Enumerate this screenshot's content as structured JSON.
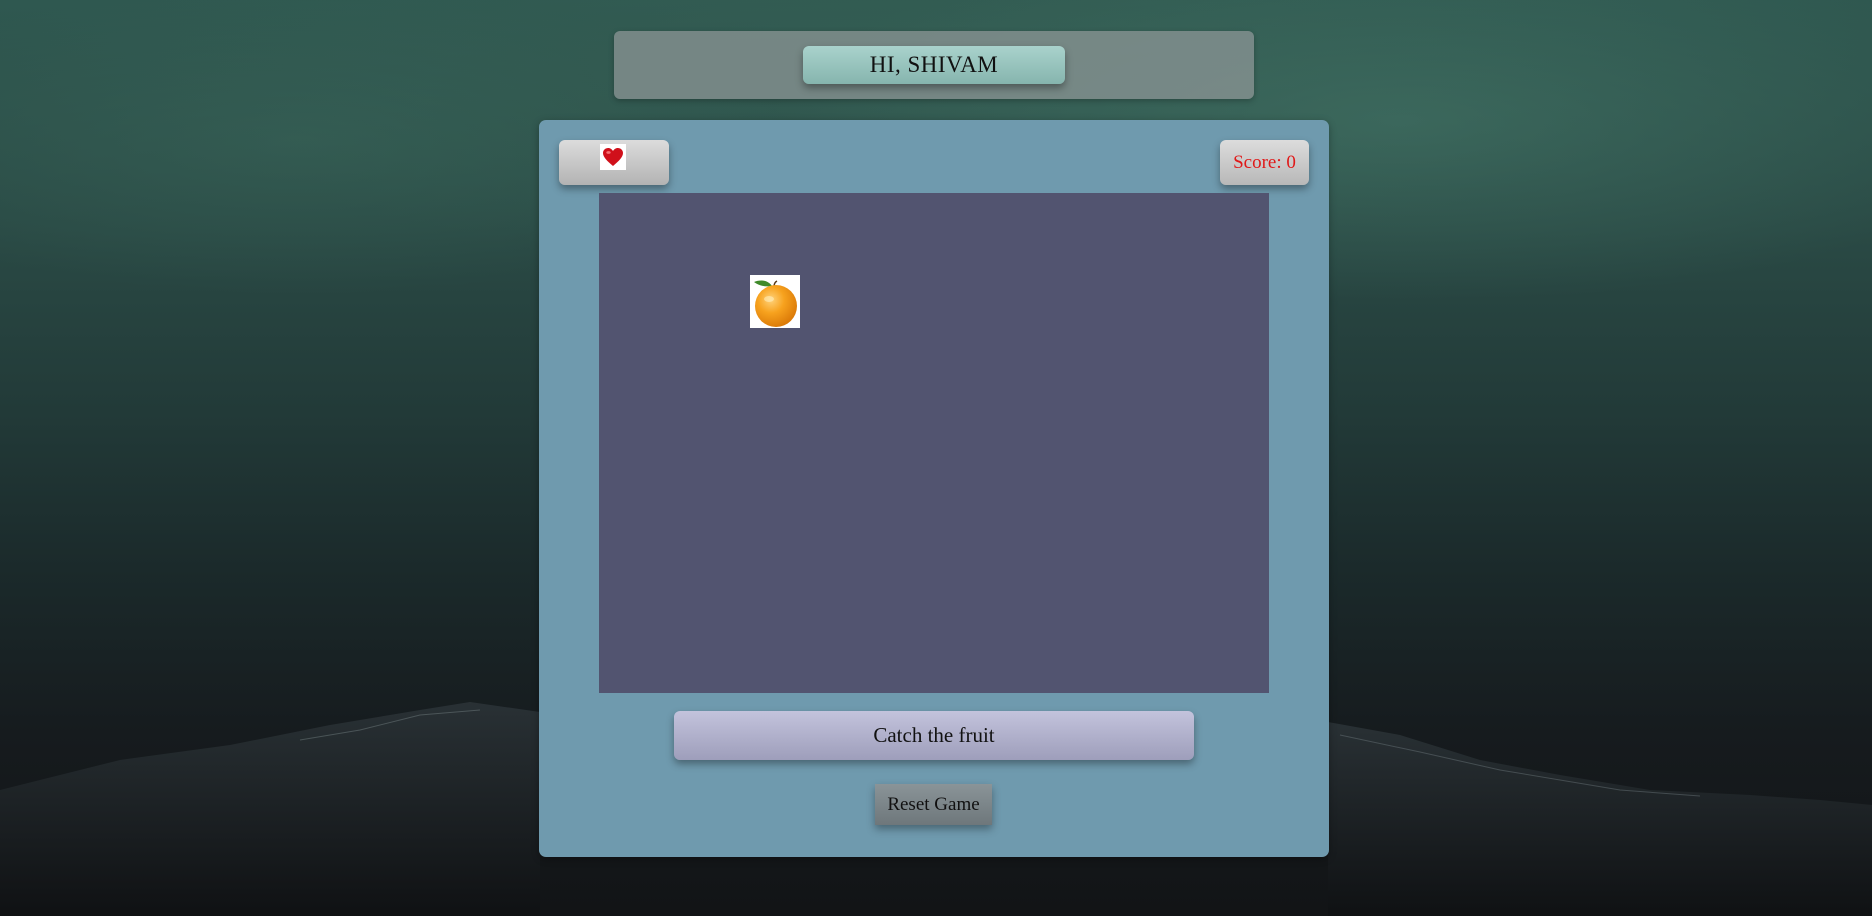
{
  "header": {
    "greeting": "HI, SHIVAM"
  },
  "status": {
    "lives_icon": "heart-icon",
    "lives": 1,
    "score_label": "Score: 0"
  },
  "play_area": {
    "fruit": "orange"
  },
  "controls": {
    "start_label": "Catch the fruit",
    "reset_label": "Reset Game"
  },
  "colors": {
    "play_area": "#525470",
    "panel": "#6f9aae",
    "score_text": "#e01818"
  }
}
